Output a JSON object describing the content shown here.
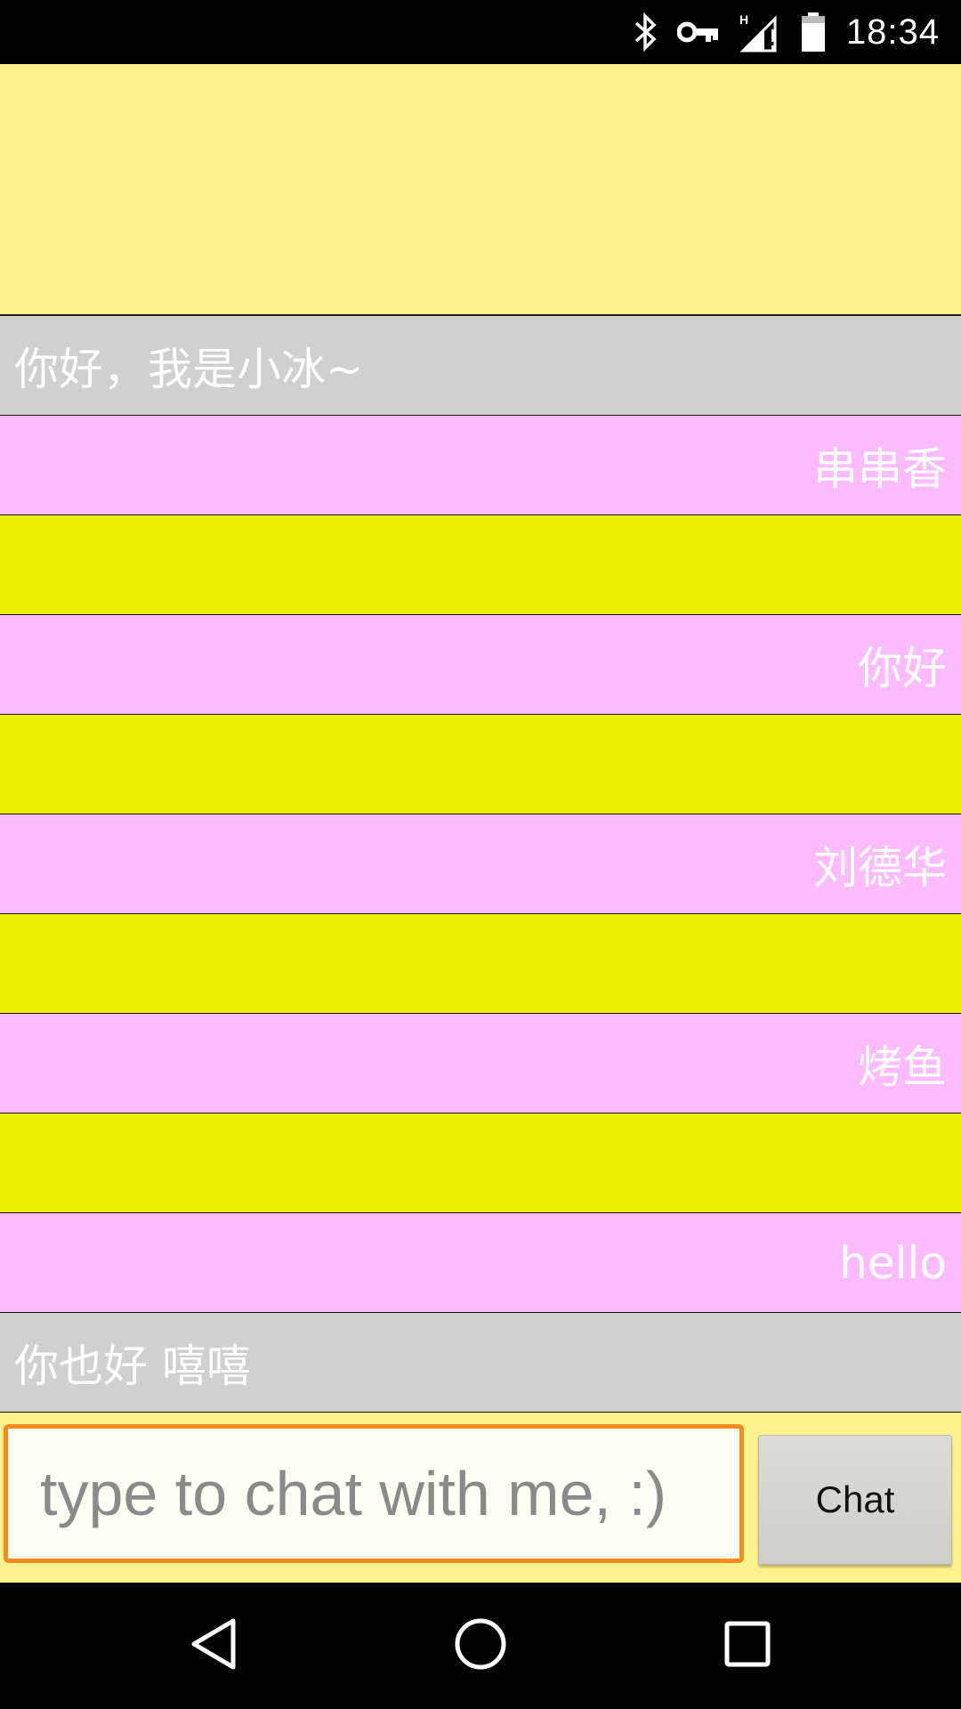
{
  "status_bar": {
    "time": "18:34",
    "icons": [
      "bluetooth-icon",
      "vpn-key-icon",
      "signal-h-icon",
      "battery-icon"
    ]
  },
  "messages": [
    {
      "role": "bot",
      "text": "你好，我是小冰~"
    },
    {
      "role": "user",
      "text": "串串香"
    },
    {
      "role": "empty",
      "text": ""
    },
    {
      "role": "user",
      "text": "你好"
    },
    {
      "role": "empty",
      "text": ""
    },
    {
      "role": "user",
      "text": "刘德华"
    },
    {
      "role": "empty",
      "text": ""
    },
    {
      "role": "user",
      "text": "烤鱼"
    },
    {
      "role": "empty",
      "text": ""
    },
    {
      "role": "user",
      "text": "hello"
    },
    {
      "role": "bot",
      "text": "你也好 嘻嘻"
    }
  ],
  "input": {
    "placeholder": "type to chat with me, :)",
    "value": ""
  },
  "chat_button": {
    "label": "Chat"
  },
  "nav_bar": {
    "icons": [
      "back-icon",
      "home-icon",
      "recents-icon"
    ]
  },
  "colors": {
    "background": "#fef28c",
    "bot_row": "#d0d0d0",
    "user_row": "#ffbbff",
    "empty_row": "#eeee00",
    "input_border": "#f58a1f"
  }
}
